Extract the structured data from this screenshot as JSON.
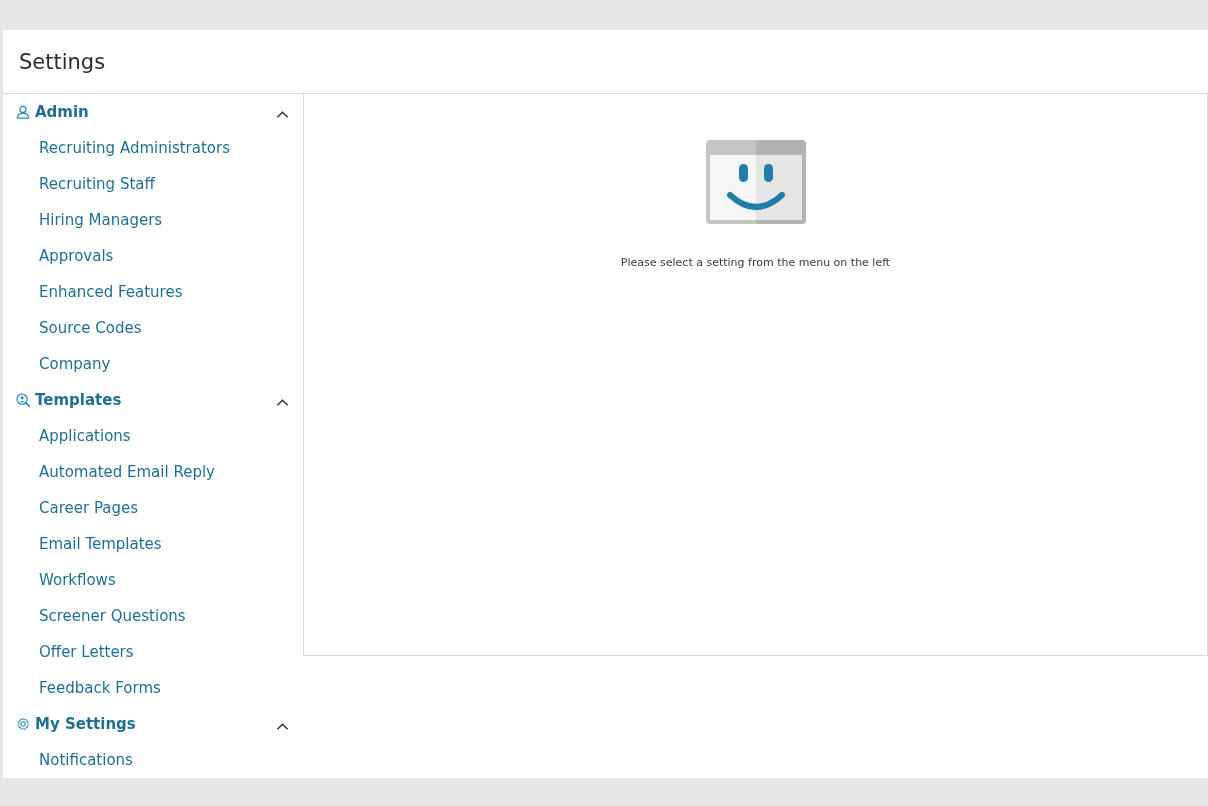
{
  "page": {
    "title": "Settings"
  },
  "sidebar": {
    "sections": [
      {
        "label": "Admin",
        "kind": "user",
        "expanded": true,
        "items": [
          "Recruiting Administrators",
          "Recruiting Staff",
          "Hiring Managers",
          "Approvals",
          "Enhanced Features",
          "Source Codes",
          "Company"
        ]
      },
      {
        "label": "Templates",
        "kind": "search-person",
        "expanded": true,
        "items": [
          "Applications",
          "Automated Email Reply",
          "Career Pages",
          "Email Templates",
          "Workflows",
          "Screener Questions",
          "Offer Letters",
          "Feedback Forms"
        ]
      },
      {
        "label": "My Settings",
        "kind": "gear",
        "expanded": true,
        "items": [
          "Notifications"
        ]
      }
    ]
  },
  "content": {
    "message": "Please select a setting from the menu on the left"
  }
}
